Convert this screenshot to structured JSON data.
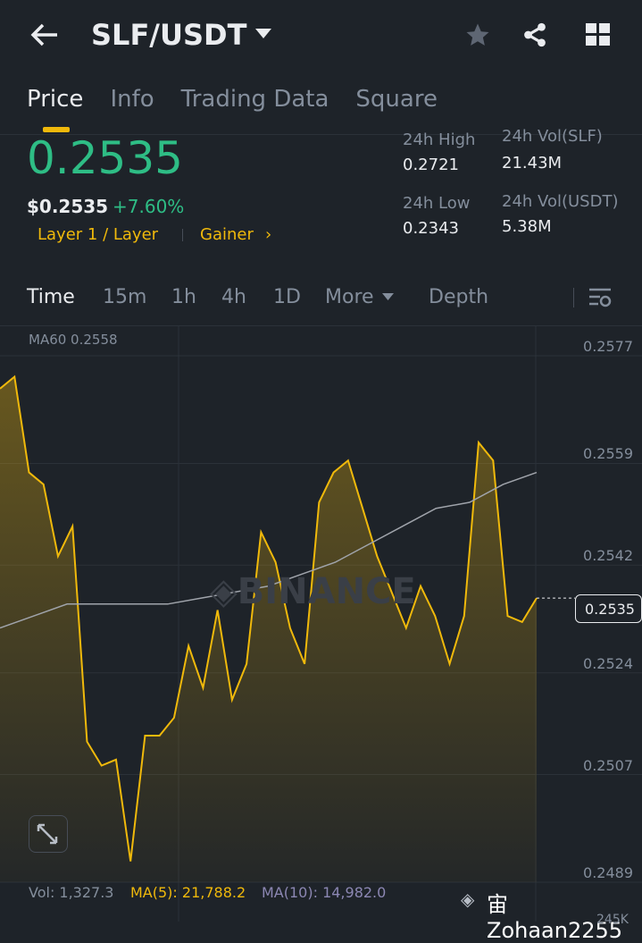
{
  "header": {
    "pair": "SLF/USDT"
  },
  "tabs": [
    "Price",
    "Info",
    "Trading Data",
    "Square"
  ],
  "price": {
    "last": "0.2535",
    "usd": "$0.2535",
    "change": "+7.60%",
    "tag1": "Layer 1 / Layer",
    "tag2": "Gainer"
  },
  "stats": {
    "high_label": "24h High",
    "high": "0.2721",
    "low_label": "24h Low",
    "low": "0.2343",
    "vol_base_label": "24h Vol(SLF)",
    "vol_base": "21.43M",
    "vol_quote_label": "24h Vol(USDT)",
    "vol_quote": "5.38M"
  },
  "time_tabs": [
    "Time",
    "15m",
    "1h",
    "4h",
    "1D",
    "More",
    "Depth"
  ],
  "ma60_label": "MA60 0.2558",
  "footer": {
    "vol": "Vol: 1,327.3",
    "ma5": "MA(5): 21,788.2",
    "ma10": "MA(10): 14,982.0",
    "watermark": "宙Zohaan2255",
    "cut": "245K"
  },
  "colors": {
    "up": "#2ebd85",
    "accent": "#f0b90b",
    "bg": "#1e2329"
  },
  "chart_data": {
    "type": "line",
    "yticks": [
      "0.2577",
      "0.2559",
      "0.2542",
      "0.2524",
      "0.2507",
      "0.2489"
    ],
    "ylim": [
      0.2489,
      0.2577
    ],
    "current": "0.2535",
    "price": [
      0.257,
      0.2572,
      0.2556,
      0.2554,
      0.2542,
      0.2547,
      0.2511,
      0.2507,
      0.2508,
      0.2491,
      0.2512,
      0.2512,
      0.2515,
      0.2527,
      0.252,
      0.2533,
      0.2518,
      0.2524,
      0.2546,
      0.2541,
      0.253,
      0.2524,
      0.2551,
      0.2556,
      0.2558,
      0.255,
      0.2542,
      0.2536,
      0.253,
      0.2537,
      0.2532,
      0.2524,
      0.2532,
      0.2561,
      0.2558,
      0.2532,
      0.2531,
      0.2535
    ],
    "ma60": [
      0.253,
      0.2532,
      0.2534,
      0.2534,
      0.2534,
      0.2534,
      0.2535,
      0.2536,
      0.2537,
      0.2539,
      0.2541,
      0.2544,
      0.2547,
      0.255,
      0.2551,
      0.2554,
      0.2556
    ]
  }
}
